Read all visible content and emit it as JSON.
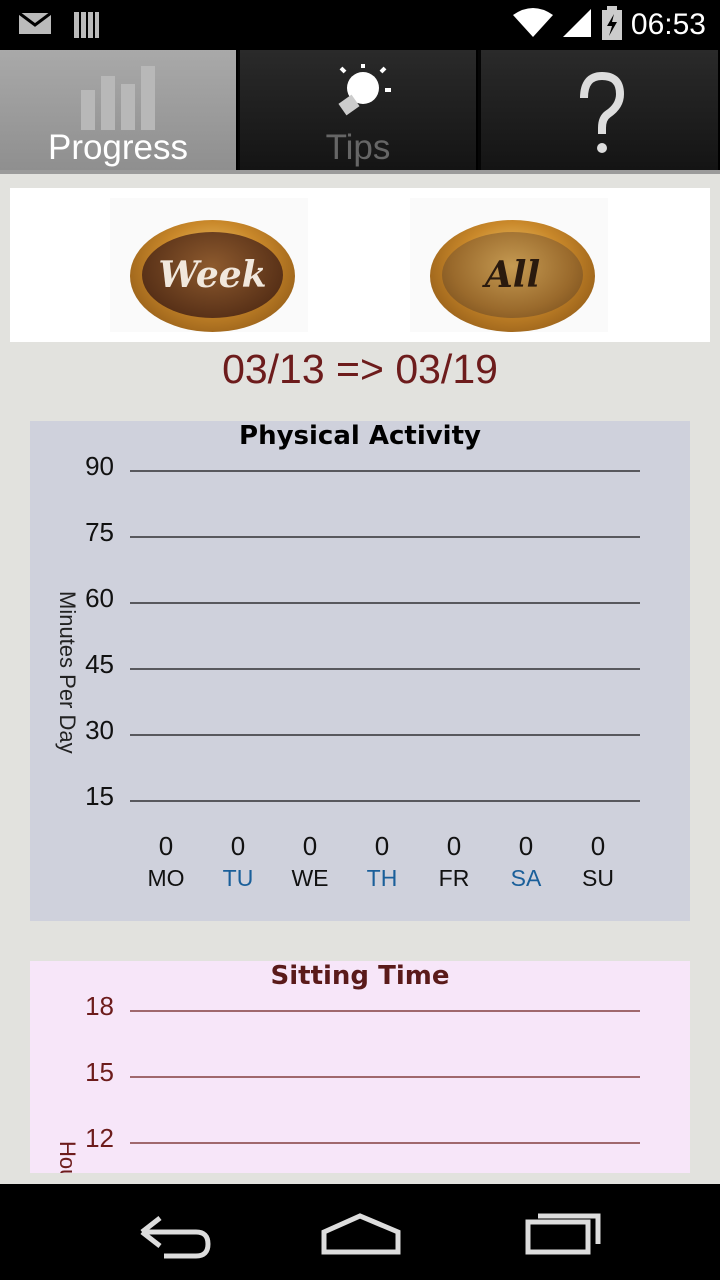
{
  "status_bar": {
    "time": "06:53"
  },
  "tabs": [
    {
      "label": "Progress",
      "icon": "bar-chart-icon",
      "active": true
    },
    {
      "label": "Tips",
      "icon": "lightbulb-icon",
      "active": false
    },
    {
      "label": "",
      "icon": "help-icon",
      "active": false
    }
  ],
  "buttons": {
    "week_label": "Week",
    "all_label": "All"
  },
  "date_range": "03/13 => 03/19",
  "physical_activity": {
    "chart_data": {
      "type": "bar",
      "title": "Physical Activity",
      "ylabel": "Minutes Per Day",
      "yticks": [
        90,
        75,
        60,
        45,
        30,
        15
      ],
      "ylim": [
        15,
        90
      ],
      "categories": [
        "MO",
        "TU",
        "WE",
        "TH",
        "FR",
        "SA",
        "SU"
      ],
      "values": [
        0,
        0,
        0,
        0,
        0,
        0,
        0
      ],
      "category_colors": [
        "#111111",
        "#1a5f9a",
        "#111111",
        "#1a5f9a",
        "#111111",
        "#1a5f9a",
        "#111111"
      ],
      "grid": true
    },
    "background": "#cfd1dc"
  },
  "sitting_time": {
    "chart_data": {
      "type": "bar",
      "title": "Sitting Time",
      "ylabel": "Hours Per Day",
      "yticks": [
        18,
        15,
        12
      ],
      "grid": true
    },
    "background": "#f7e6f9",
    "accent": "#6d1c1c"
  }
}
